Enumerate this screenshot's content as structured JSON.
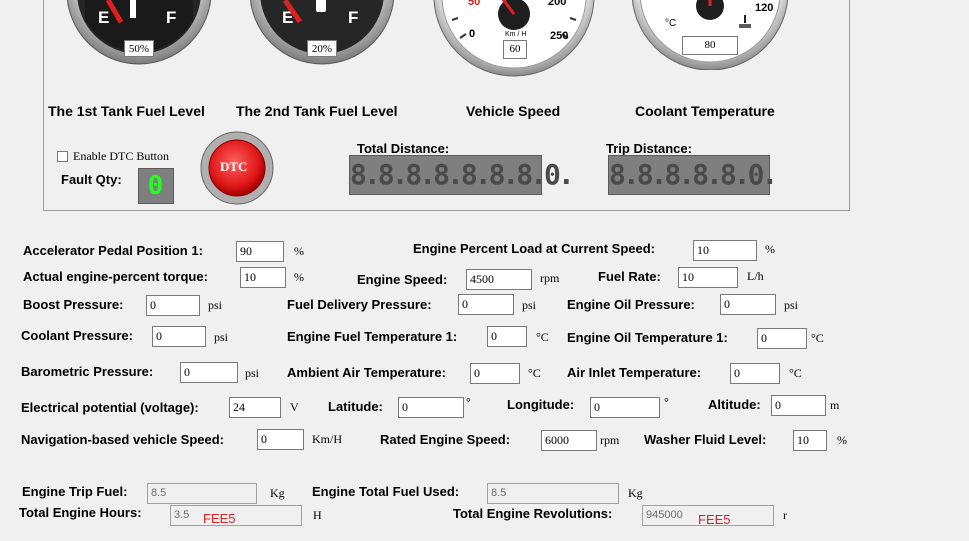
{
  "gauges": [
    {
      "id": "tank1",
      "label": "The 1st Tank Fuel Level",
      "readout": "50%",
      "left": "E",
      "right": "F"
    },
    {
      "id": "tank2",
      "label": "The 2nd Tank Fuel Level",
      "readout": "20%",
      "left": "E",
      "right": "F"
    },
    {
      "id": "speed",
      "label": "Vehicle Speed",
      "readout": "60",
      "unit": "Km / H",
      "tick_left": "0",
      "tick_right": "250",
      "tick_top_left": "50",
      "tick_top_right": "200"
    },
    {
      "id": "coolant",
      "label": "Coolant Temperature",
      "readout": "80",
      "unit": "°C",
      "tick_right": "120"
    }
  ],
  "dtc": {
    "enable_label": "Enable DTC Button",
    "fault_qty_label": "Fault Qty:",
    "fault_qty_value": "0",
    "button_label": "DTC"
  },
  "odometer": {
    "total_label": "Total Distance:",
    "total_value": "8.8.8.8.8.8.8.0.",
    "trip_label": "Trip Distance:",
    "trip_value": "8.8.8.8.8.0."
  },
  "params": {
    "accel_pedal": {
      "label": "Accelerator Pedal Position 1:",
      "value": "90",
      "unit": "%"
    },
    "actual_torque": {
      "label": "Actual engine-percent torque:",
      "value": "10",
      "unit": "%"
    },
    "percent_load": {
      "label": "Engine Percent Load at Current Speed:",
      "value": "10",
      "unit": "%"
    },
    "engine_speed": {
      "label": "Engine Speed:",
      "value": "4500",
      "unit": "rpm"
    },
    "fuel_rate": {
      "label": "Fuel Rate:",
      "value": "10",
      "unit": "L/h"
    },
    "boost_pressure": {
      "label": "Boost Pressure:",
      "value": "0",
      "unit": "psi"
    },
    "fuel_delivery_pressure": {
      "label": "Fuel Delivery Pressure:",
      "value": "0",
      "unit": "psi"
    },
    "engine_oil_pressure": {
      "label": "Engine Oil Pressure:",
      "value": "0",
      "unit": "psi"
    },
    "coolant_pressure": {
      "label": "Coolant Pressure:",
      "value": "0",
      "unit": "psi"
    },
    "engine_fuel_temp": {
      "label": "Engine Fuel Temperature 1:",
      "value": "0",
      "unit": "°C"
    },
    "engine_oil_temp": {
      "label": "Engine Oil Temperature 1:",
      "value": "0",
      "unit": "°C"
    },
    "barometric_pressure": {
      "label": "Barometric Pressure:",
      "value": "0",
      "unit": "psi"
    },
    "ambient_air_temp": {
      "label": "Ambient Air Temperature:",
      "value": "0",
      "unit": "°C"
    },
    "air_inlet_temp": {
      "label": "Air Inlet Temperature:",
      "value": "0",
      "unit": "°C"
    },
    "electrical_potential": {
      "label": "Electrical potential (voltage):",
      "value": "24",
      "unit": "V"
    },
    "latitude": {
      "label": "Latitude:",
      "value": "0",
      "unit": "°"
    },
    "longitude": {
      "label": "Longitude:",
      "value": "0",
      "unit": "°"
    },
    "altitude": {
      "label": "Altitude:",
      "value": "0",
      "unit": "m"
    },
    "nav_speed": {
      "label": "Navigation-based vehicle Speed:",
      "value": "0",
      "unit": "Km/H"
    },
    "rated_engine_speed": {
      "label": "Rated Engine Speed:",
      "value": "6000",
      "unit": "rpm"
    },
    "washer_fluid": {
      "label": "Washer Fluid Level:",
      "value": "10",
      "unit": "%"
    }
  },
  "readonly": {
    "trip_fuel": {
      "label": "Engine Trip Fuel:",
      "value": "8.5",
      "unit": "Kg"
    },
    "total_fuel": {
      "label": "Engine Total Fuel Used:",
      "value": "8.5",
      "unit": "Kg"
    },
    "engine_hours": {
      "label": "Total Engine Hours:",
      "value": "3.5",
      "tag": "FEE5",
      "unit": "H"
    },
    "engine_revs": {
      "label": "Total Engine Revolutions:",
      "value": "945000",
      "tag": "FEE5",
      "unit": "r"
    }
  },
  "colors": {
    "background": "#f0f0f0",
    "segment_on": "#20ff20",
    "dtc_button": "#e01818",
    "fee_tag": "#e02020"
  }
}
